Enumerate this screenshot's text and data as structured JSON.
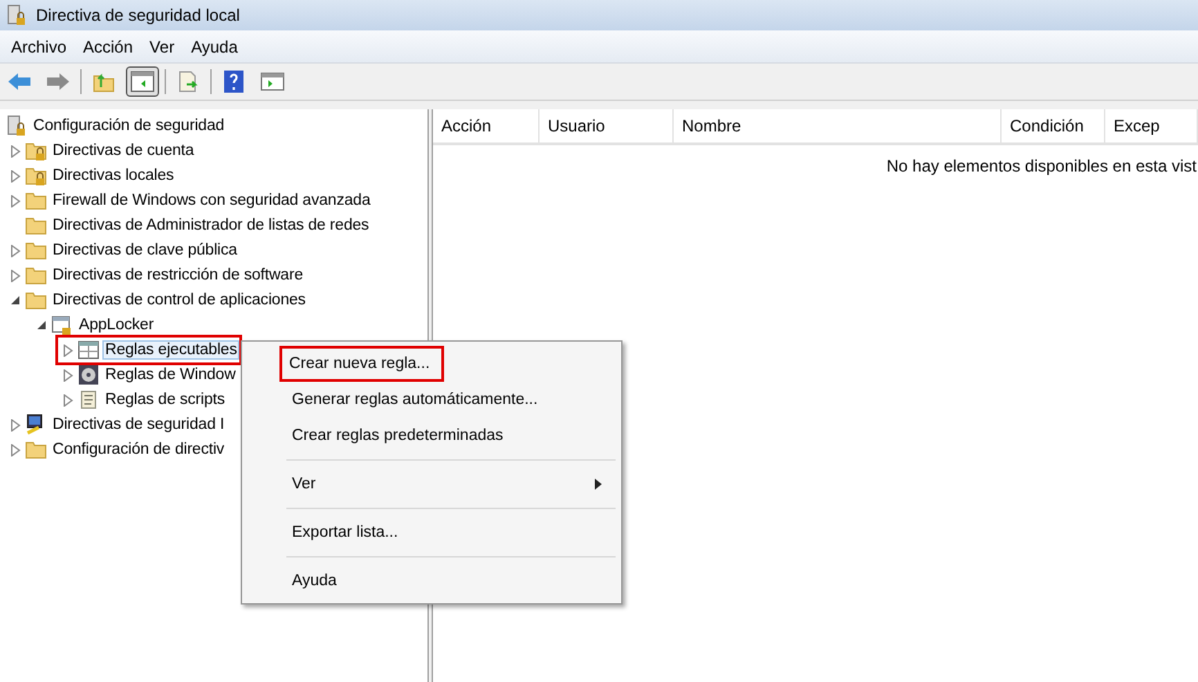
{
  "window": {
    "title": "Directiva de seguridad local"
  },
  "menu": [
    "Archivo",
    "Acción",
    "Ver",
    "Ayuda"
  ],
  "toolbar": [
    {
      "kind": "back"
    },
    {
      "kind": "forward"
    },
    {
      "kind": "sep"
    },
    {
      "kind": "up"
    },
    {
      "kind": "pane",
      "selected": true
    },
    {
      "kind": "sep"
    },
    {
      "kind": "export"
    },
    {
      "kind": "sep"
    },
    {
      "kind": "help"
    },
    {
      "kind": "panel"
    }
  ],
  "tree": {
    "label": "Configuración de seguridad",
    "kind": "root",
    "children": [
      {
        "label": "Directivas de cuenta",
        "kind": "lockfolder",
        "expanded": false,
        "selected": false,
        "highlighted": false
      },
      {
        "label": "Directivas locales",
        "kind": "lockfolder",
        "expanded": false,
        "selected": false,
        "highlighted": false
      },
      {
        "label": "Firewall de Windows con seguridad avanzada",
        "kind": "folder",
        "expanded": false,
        "selected": false,
        "highlighted": false
      },
      {
        "label": "Directivas de Administrador de listas de redes",
        "kind": "folder",
        "selected": false,
        "highlighted": false
      },
      {
        "label": "Directivas de clave pública",
        "kind": "folder",
        "expanded": false,
        "selected": false,
        "highlighted": false
      },
      {
        "label": "Directivas de restricción de software",
        "kind": "folder",
        "expanded": false,
        "selected": false,
        "highlighted": false
      },
      {
        "label": "Directivas de control de aplicaciones",
        "kind": "folder",
        "expanded": true,
        "selected": false,
        "highlighted": false,
        "children": [
          {
            "label": "AppLocker",
            "kind": "applocker",
            "expanded": true,
            "selected": false,
            "highlighted": false,
            "children": [
              {
                "label": "Reglas ejecutables",
                "kind": "rules",
                "expanded": false,
                "selected": true,
                "highlighted": true
              },
              {
                "label": "Reglas de Window",
                "kind": "disc",
                "expanded": false,
                "selected": false,
                "highlighted": false
              },
              {
                "label": "Reglas de scripts",
                "kind": "script",
                "expanded": false,
                "selected": false,
                "highlighted": false
              }
            ]
          }
        ]
      },
      {
        "label": "Directivas de seguridad I",
        "kind": "network",
        "expanded": false,
        "selected": false,
        "highlighted": false
      },
      {
        "label": "Configuración de directiv",
        "kind": "folder",
        "expanded": false,
        "selected": false,
        "highlighted": false
      }
    ]
  },
  "list": {
    "columns": [
      "Acción",
      "Usuario",
      "Nombre",
      "Condición",
      "Excep"
    ],
    "empty_message": "No hay elementos disponibles en esta vist"
  },
  "context_menu": [
    {
      "kind": "item",
      "label": "Crear nueva regla...",
      "highlighted": true,
      "submenu": false
    },
    {
      "kind": "item",
      "label": "Generar reglas automáticamente...",
      "highlighted": false,
      "submenu": false
    },
    {
      "kind": "item",
      "label": "Crear reglas predeterminadas",
      "highlighted": false,
      "submenu": false
    },
    {
      "kind": "separator"
    },
    {
      "kind": "item",
      "label": "Ver",
      "highlighted": false,
      "submenu": true
    },
    {
      "kind": "separator"
    },
    {
      "kind": "item",
      "label": "Exportar lista...",
      "highlighted": false,
      "submenu": false
    },
    {
      "kind": "separator"
    },
    {
      "kind": "item",
      "label": "Ayuda",
      "highlighted": false,
      "submenu": false
    }
  ]
}
